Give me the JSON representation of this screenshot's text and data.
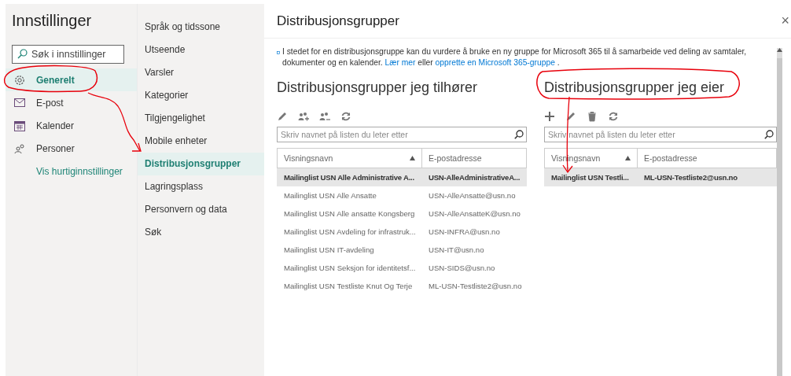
{
  "settings_nav": {
    "title": "Innstillinger",
    "search": {
      "placeholder": "Søk i innstillinger"
    },
    "items": [
      {
        "label": "Generelt",
        "selected": true
      },
      {
        "label": "E-post",
        "selected": false
      },
      {
        "label": "Kalender",
        "selected": false
      },
      {
        "label": "Personer",
        "selected": false
      }
    ],
    "quick_link": "Vis hurtiginnstillinger"
  },
  "sub_nav": {
    "items": [
      {
        "label": "Språk og tidssone",
        "selected": false
      },
      {
        "label": "Utseende",
        "selected": false
      },
      {
        "label": "Varsler",
        "selected": false
      },
      {
        "label": "Kategorier",
        "selected": false
      },
      {
        "label": "Tilgjengelighet",
        "selected": false
      },
      {
        "label": "Mobile enheter",
        "selected": false
      },
      {
        "label": "Distribusjonsgrupper",
        "selected": true
      },
      {
        "label": "Lagringsplass",
        "selected": false
      },
      {
        "label": "Personvern og data",
        "selected": false
      },
      {
        "label": "Søk",
        "selected": false
      }
    ]
  },
  "panel": {
    "title": "Distribusjonsgrupper",
    "close": "×",
    "notice": [
      {
        "kind": "text",
        "text": "I stedet for en distribusjonsgruppe kan du vurdere å bruke en ny gruppe for Microsoft 365 til å samarbeide ved deling av samtaler, dokumenter og en kalender. "
      },
      {
        "kind": "link",
        "text": "Lær mer"
      },
      {
        "kind": "text",
        "text": " eller "
      },
      {
        "kind": "link",
        "text": "opprette en Microsoft 365-gruppe"
      },
      {
        "kind": "text",
        "text": " ."
      }
    ],
    "sections": [
      {
        "heading": "Distribusjonsgrupper jeg tilhører",
        "search": {
          "placeholder": "Skriv navnet på listen du leter etter"
        },
        "columns": [
          {
            "label": "Visningsnavn",
            "sorted": true
          },
          {
            "label": "E-postadresse",
            "sorted": false
          }
        ],
        "rows": [
          {
            "cells": [
              "Mailinglist USN Alle Administrative A...",
              "USN-AlleAdministrativeA..."
            ],
            "selected": true
          },
          {
            "cells": [
              "Mailinglist USN Alle Ansatte",
              "USN-AlleAnsatte@usn.no"
            ],
            "selected": false
          },
          {
            "cells": [
              "Mailinglist USN Alle ansatte Kongsberg",
              "USN-AlleAnsatteK@usn.no"
            ],
            "selected": false
          },
          {
            "cells": [
              "Mailinglist USN Avdeling for infrastruk...",
              "USN-INFRA@usn.no"
            ],
            "selected": false
          },
          {
            "cells": [
              "Mailinglist USN IT-avdeling",
              "USN-IT@usn.no"
            ],
            "selected": false
          },
          {
            "cells": [
              "Mailinglist USN Seksjon for identitetsf...",
              "USN-SIDS@usn.no"
            ],
            "selected": false
          },
          {
            "cells": [
              "Mailinglist USN Testliste Knut Og Terje",
              "ML-USN-Testliste2@usn.no"
            ],
            "selected": false
          }
        ]
      },
      {
        "heading": "Distribusjonsgrupper jeg eier",
        "search": {
          "placeholder": "Skriv navnet på listen du leter etter"
        },
        "columns": [
          {
            "label": "Visningsnavn",
            "sorted": true
          },
          {
            "label": "E-postadresse",
            "sorted": false
          }
        ],
        "rows": [
          {
            "cells": [
              "Mailinglist USN Testli...",
              "ML-USN-Testliste2@usn.no"
            ],
            "selected": true
          }
        ]
      }
    ]
  }
}
